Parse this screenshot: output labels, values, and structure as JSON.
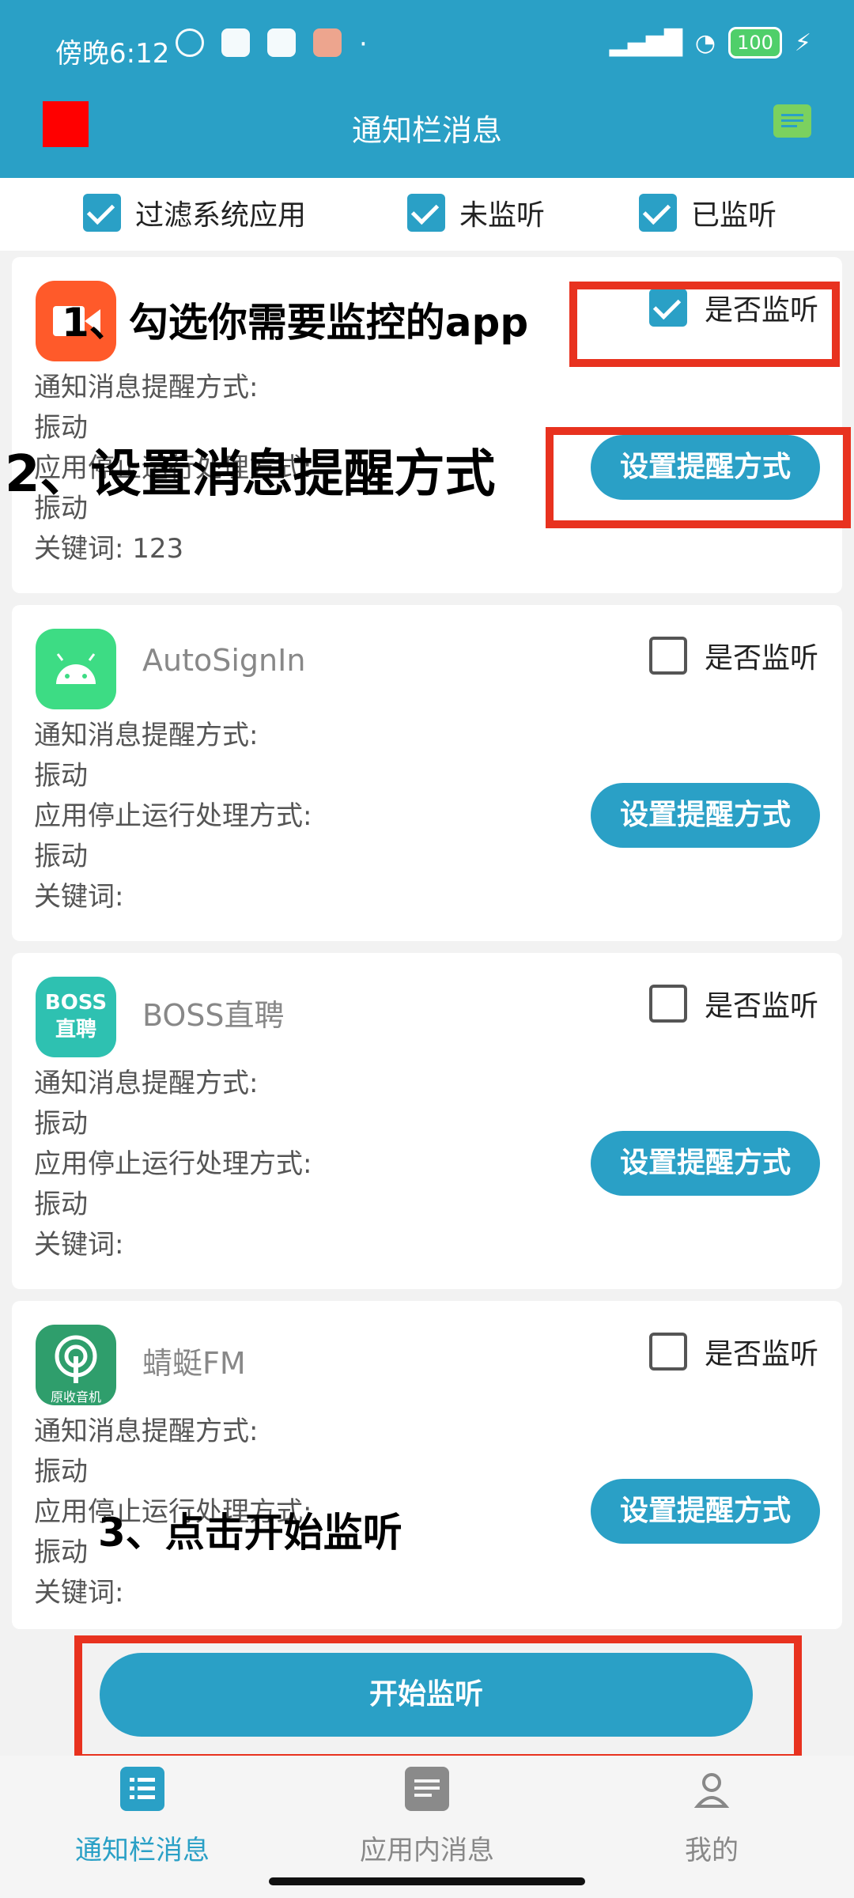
{
  "status_bar": {
    "time": "傍晚6:12",
    "battery": "100",
    "dot": "·"
  },
  "header": {
    "title": "通知栏消息"
  },
  "filters": [
    {
      "label": "过滤系统应用",
      "checked": true
    },
    {
      "label": "未监听",
      "checked": true
    },
    {
      "label": "已监听",
      "checked": true
    }
  ],
  "apps": [
    {
      "name": "",
      "monitor_label": "是否监听",
      "monitored": true,
      "notify_label": "通知消息提醒方式:",
      "notify_value": "振动",
      "stop_label": "应用停止运行处理方式:",
      "stop_value": "振动",
      "keywords_label": "关键词:",
      "keywords_value": "123",
      "button": "设置提醒方式",
      "icon": "video-icon",
      "color": "#ff5a2a"
    },
    {
      "name": "AutoSignIn",
      "monitor_label": "是否监听",
      "monitored": false,
      "notify_label": "通知消息提醒方式:",
      "notify_value": "振动",
      "stop_label": "应用停止运行处理方式:",
      "stop_value": "振动",
      "keywords_label": "关键词:",
      "keywords_value": "",
      "button": "设置提醒方式",
      "icon": "android-icon",
      "color": "#3ddc84"
    },
    {
      "name": "BOSS直聘",
      "monitor_label": "是否监听",
      "monitored": false,
      "notify_label": "通知消息提醒方式:",
      "notify_value": "振动",
      "stop_label": "应用停止运行处理方式:",
      "stop_value": "振动",
      "keywords_label": "关键词:",
      "keywords_value": "",
      "button": "设置提醒方式",
      "icon": "boss-icon",
      "color": "#2ec1b1",
      "icon_text": "BOSS\n直聘"
    },
    {
      "name": "蜻蜓FM",
      "monitor_label": "是否监听",
      "monitored": false,
      "notify_label": "通知消息提醒方式:",
      "notify_value": "振动",
      "stop_label": "应用停止运行处理方式:",
      "stop_value": "振动",
      "keywords_label": "关键词:",
      "keywords_value": "",
      "button": "设置提醒方式",
      "icon": "radio-icon",
      "color": "#2f9e6c",
      "icon_text": "原收音机"
    }
  ],
  "annotations": {
    "step1": "1、勾选你需要监控的app",
    "step2": "2、设置消息提醒方式",
    "step3": "3、点击开始监听"
  },
  "start_button": "开始监听",
  "bottom_nav": [
    {
      "label": "通知栏消息",
      "active": true,
      "icon": "notification-list-icon"
    },
    {
      "label": "应用内消息",
      "active": false,
      "icon": "message-icon"
    },
    {
      "label": "我的",
      "active": false,
      "icon": "profile-icon"
    }
  ],
  "colors": {
    "primary": "#2aa0c6",
    "annotation_red": "#e8321f",
    "accent_green": "#7bd15f"
  }
}
